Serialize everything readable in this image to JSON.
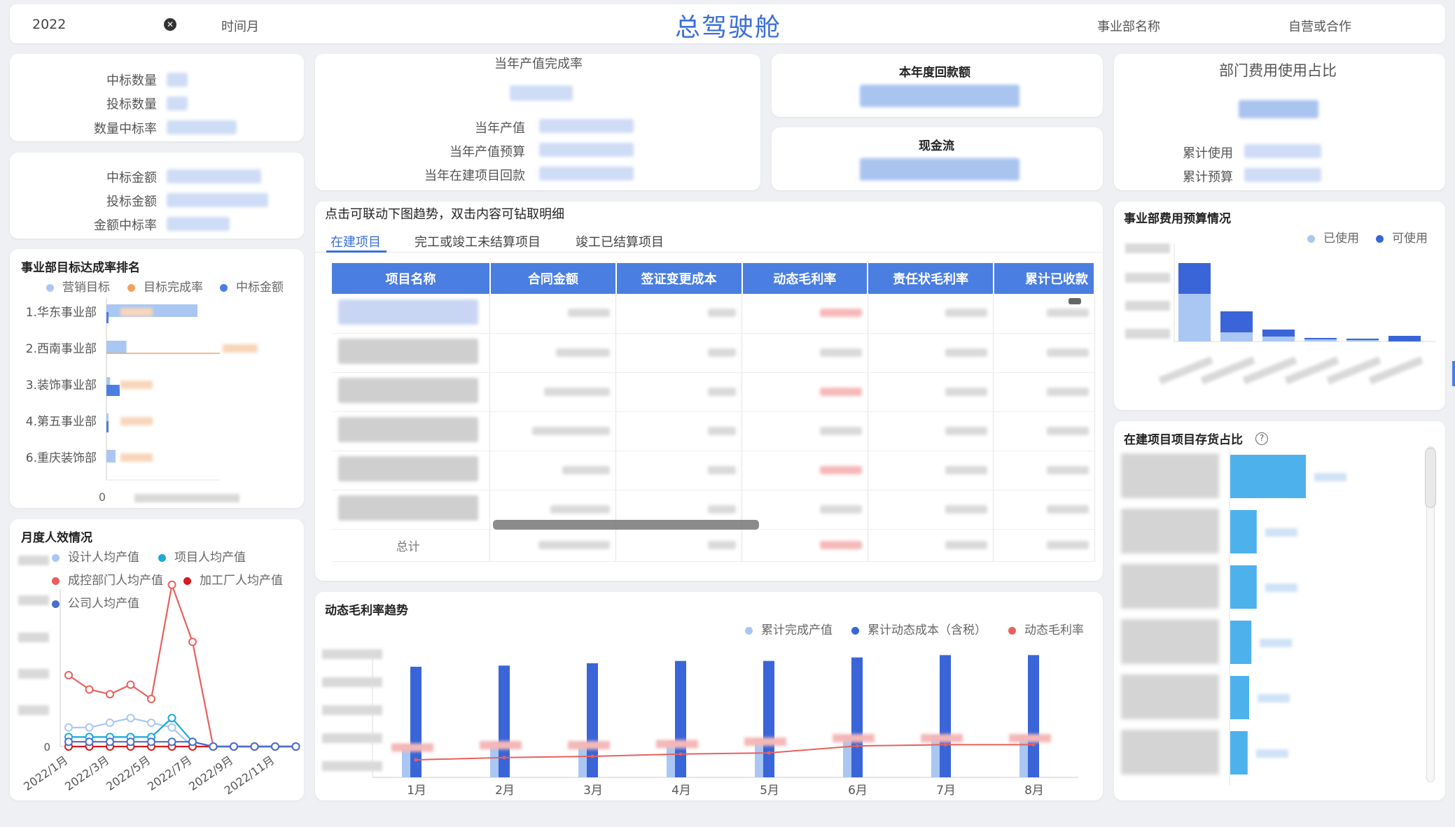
{
  "header": {
    "year_value": "2022",
    "time_label": "时间月",
    "page_title": "总驾驶舱",
    "dept_filter_label": "事业部名称",
    "mode_filter_label": "自营或合作"
  },
  "bid_count_card": {
    "labels": [
      "中标数量",
      "投标数量",
      "数量中标率"
    ]
  },
  "bid_amount_card": {
    "labels": [
      "中标金额",
      "投标金额",
      "金额中标率"
    ]
  },
  "output_card": {
    "title": "当年产值完成率",
    "labels": [
      "当年产值",
      "当年产值预算",
      "当年在建项目回款"
    ]
  },
  "payment_card": {
    "title": "本年度回款额"
  },
  "cashflow_card": {
    "title": "现金流"
  },
  "dept_cost_card": {
    "title": "部门费用使用占比",
    "labels": [
      "累计使用",
      "累计预算"
    ]
  },
  "ranking_chart": {
    "title": "事业部目标达成率排名",
    "legend": [
      "营销目标",
      "目标完成率",
      "中标金额"
    ],
    "categories": [
      "1.华东事业部",
      "2.西南事业部",
      "3.装饰事业部",
      "4.第五事业部",
      "6.重庆装饰部"
    ],
    "x_zero": "0"
  },
  "project_table": {
    "hint": "点击可联动下图趋势，双击内容可钻取明细",
    "tabs": [
      "在建项目",
      "完工或竣工未结算项目",
      "竣工已结算项目"
    ],
    "columns": [
      "项目名称",
      "合同金额",
      "签证变更成本",
      "动态毛利率",
      "责任状毛利率",
      "累计已收款"
    ],
    "total_label": "总计"
  },
  "monthly_chart": {
    "title": "月度人效情况",
    "legend": [
      "设计人均产值",
      "项目人均产值",
      "成控部门人均产值",
      "加工厂人均产值",
      "公司人均产值"
    ],
    "x_labels": [
      "2022/1月",
      "2022/3月",
      "2022/5月",
      "2022/7月",
      "2022/9月",
      "2022/11月"
    ],
    "y_zero": "0"
  },
  "margin_chart": {
    "title": "动态毛利率趋势",
    "legend": [
      "累计完成产值",
      "累计动态成本（含税）",
      "动态毛利率"
    ],
    "categories": [
      "1月",
      "2月",
      "3月",
      "4月",
      "5月",
      "6月",
      "7月",
      "8月"
    ]
  },
  "budget_chart": {
    "title": "事业部费用预算情况",
    "legend": [
      "已使用",
      "可使用"
    ]
  },
  "inventory_chart": {
    "title": "在建项目项目存货占比"
  },
  "icons": {
    "clear": "clear-icon",
    "help": "help-icon"
  },
  "colors": {
    "primary": "#4a7ee0",
    "title_blue": "#3b6fd8",
    "light_blue": "#a9c7f2",
    "orange": "#f3a160",
    "red": "#e8605c",
    "cyan": "#1aa9d8",
    "sky": "#4db2ec"
  },
  "chart_data": [
    {
      "type": "bar",
      "title": "事业部目标达成率排名",
      "categories": [
        "1.华东事业部",
        "2.西南事业部",
        "3.装饰事业部",
        "4.第五事业部",
        "6.重庆装饰部"
      ],
      "series": [
        {
          "name": "营销目标",
          "values": [
            100,
            22,
            4,
            1,
            10
          ]
        },
        {
          "name": "中标金额",
          "values": [
            3,
            0,
            19,
            1,
            0
          ]
        }
      ]
    },
    {
      "type": "line",
      "title": "月度人效情况",
      "x": [
        "1",
        "2",
        "3",
        "4",
        "5",
        "6",
        "7",
        "8",
        "9",
        "10",
        "11",
        "12"
      ],
      "series": [
        {
          "name": "设计人均产值",
          "values": [
            4,
            4,
            5,
            6,
            5,
            4,
            0,
            0,
            0,
            0,
            0,
            0
          ]
        },
        {
          "name": "项目人均产值",
          "values": [
            2,
            2,
            2,
            2,
            2,
            6,
            1,
            0,
            0,
            0,
            0,
            0
          ]
        },
        {
          "name": "成控部门人均产值",
          "values": [
            15,
            12,
            11,
            13,
            10,
            34,
            22,
            0,
            0,
            0,
            0,
            0
          ]
        },
        {
          "name": "加工厂人均产值",
          "values": [
            0,
            0,
            0,
            0,
            0,
            0,
            0,
            0,
            0,
            0,
            0,
            0
          ]
        },
        {
          "name": "公司人均产值",
          "values": [
            1,
            1,
            1,
            1,
            1,
            1,
            1,
            0,
            0,
            0,
            0,
            0
          ]
        }
      ]
    },
    {
      "type": "bar",
      "title": "动态毛利率趋势",
      "categories": [
        "1月",
        "2月",
        "3月",
        "4月",
        "5月",
        "6月",
        "7月",
        "8月"
      ],
      "series": [
        {
          "name": "累计完成产值",
          "values": [
            28,
            30,
            30,
            31,
            33,
            36,
            36,
            36
          ]
        },
        {
          "name": "累计动态成本（含税）",
          "values": [
            95,
            96,
            98,
            100,
            100,
            103,
            105,
            105
          ]
        },
        {
          "name": "动态毛利率",
          "values": [
            15,
            17,
            18,
            20,
            21,
            27,
            28,
            28
          ]
        }
      ],
      "ylim": [
        0,
        110
      ]
    },
    {
      "type": "bar",
      "title": "事业部费用预算情况",
      "series": [
        {
          "name": "已使用",
          "values": [
            68,
            13,
            7,
            3,
            2,
            0
          ]
        },
        {
          "name": "可使用",
          "values": [
            44,
            30,
            10,
            2,
            2,
            8
          ]
        }
      ]
    },
    {
      "type": "bar",
      "title": "在建项目项目存货占比",
      "series": [
        {
          "values": [
            100,
            35,
            35,
            28,
            25,
            23
          ]
        }
      ]
    }
  ]
}
